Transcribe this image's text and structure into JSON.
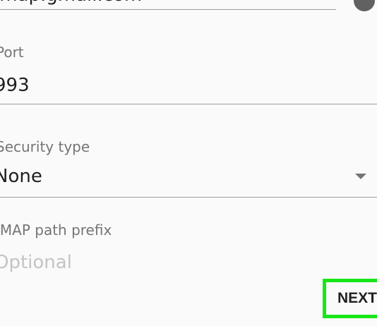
{
  "server": {
    "value": "imap.gmail.com"
  },
  "port": {
    "label": "Port",
    "value": "993"
  },
  "security": {
    "label": "Security type",
    "value": "None"
  },
  "prefix": {
    "label": "IMAP path prefix",
    "placeholder": "Optional"
  },
  "actions": {
    "next_label": "NEXT"
  },
  "icons": {
    "server_info": "info-icon",
    "dropdown": "dropdown-arrow-icon"
  },
  "colors": {
    "highlight": "#19e619",
    "text_primary": "#212121",
    "text_secondary": "#757575"
  }
}
